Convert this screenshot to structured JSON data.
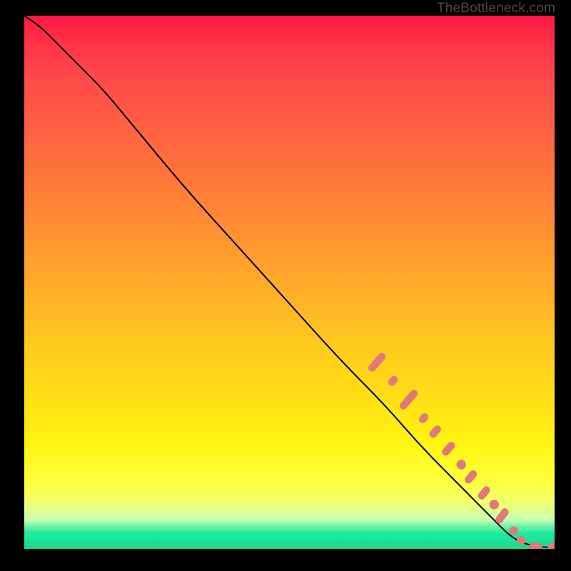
{
  "watermark": "TheBottleneck.com",
  "colors": {
    "dot": "#e07a78",
    "line": "#000000"
  },
  "chart_data": {
    "type": "line",
    "title": "",
    "xlabel": "",
    "ylabel": "",
    "xlim": [
      0,
      100
    ],
    "ylim": [
      0,
      100
    ],
    "series": [
      {
        "name": "curve",
        "x": [
          0,
          3,
          6,
          10,
          15,
          20,
          30,
          40,
          50,
          60,
          68,
          75,
          82,
          88,
          91,
          93,
          96,
          98,
          100
        ],
        "y": [
          100,
          98,
          95,
          91,
          86,
          80,
          68,
          57,
          46,
          35,
          27,
          19,
          12,
          6,
          3,
          1.5,
          0.5,
          0.3,
          0.3
        ]
      }
    ],
    "markers": [
      {
        "shape": "capsule",
        "x": 66.5,
        "y": 35.0,
        "len": 4.2,
        "angle": -49
      },
      {
        "shape": "capsule",
        "x": 69.5,
        "y": 31.5,
        "len": 2.0,
        "angle": -49
      },
      {
        "shape": "capsule",
        "x": 72.5,
        "y": 28.0,
        "len": 4.5,
        "angle": -49
      },
      {
        "shape": "capsule",
        "x": 75.3,
        "y": 24.5,
        "len": 2.0,
        "angle": -49
      },
      {
        "shape": "capsule",
        "x": 77.5,
        "y": 22.0,
        "len": 2.6,
        "angle": -49
      },
      {
        "shape": "capsule",
        "x": 80.0,
        "y": 18.8,
        "len": 3.0,
        "angle": -49
      },
      {
        "shape": "dot",
        "x": 82.4,
        "y": 15.8,
        "r": 1.2
      },
      {
        "shape": "capsule",
        "x": 84.2,
        "y": 13.5,
        "len": 2.8,
        "angle": -50
      },
      {
        "shape": "capsule",
        "x": 86.7,
        "y": 10.5,
        "len": 2.8,
        "angle": -51
      },
      {
        "shape": "dot",
        "x": 88.6,
        "y": 8.3,
        "r": 1.2
      },
      {
        "shape": "capsule",
        "x": 90.1,
        "y": 6.2,
        "len": 3.2,
        "angle": -53
      },
      {
        "shape": "dot",
        "x": 92.3,
        "y": 3.4,
        "r": 1.1
      },
      {
        "shape": "dot",
        "x": 93.7,
        "y": 1.6,
        "r": 1.1
      },
      {
        "shape": "dot",
        "x": 96.0,
        "y": 0.4,
        "r": 1.1
      },
      {
        "shape": "dot",
        "x": 97.0,
        "y": 0.35,
        "r": 1.0
      },
      {
        "shape": "dot",
        "x": 99.5,
        "y": 0.3,
        "r": 1.1
      },
      {
        "shape": "dot",
        "x": 100.3,
        "y": 0.3,
        "r": 1.0
      }
    ]
  }
}
